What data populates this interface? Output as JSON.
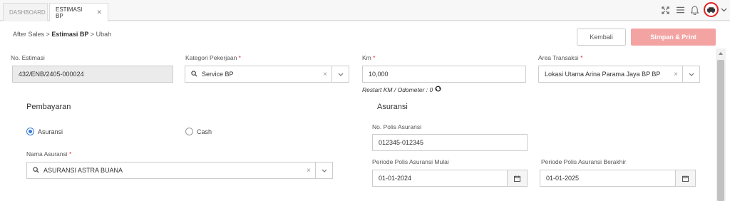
{
  "tabs": [
    {
      "label": "DASHBOARD"
    },
    {
      "label": "ESTIMASI BP"
    }
  ],
  "breadcrumb": {
    "root": "After Sales",
    "parent": "Estimasi BP",
    "current": "Ubah",
    "separator": ">"
  },
  "actions": {
    "back_label": "Kembali",
    "save_label": "Simpan & Print"
  },
  "form": {
    "no_estimasi": {
      "label": "No. Estimasi",
      "value": "432/ENB/2405-000024"
    },
    "kategori": {
      "label": "Kategori Pekerjaan",
      "required": "*",
      "value": "Service BP"
    },
    "km": {
      "label": "Km",
      "required": "*",
      "value": "10,000",
      "restart_text": "Restart KM / Odometer : 0"
    },
    "area": {
      "label": "Area Transaksi",
      "required": "*",
      "value": "Lokasi Utama Arina Parama Jaya BP BP"
    }
  },
  "pembayaran": {
    "title": "Pembayaran",
    "options": [
      {
        "label": "Asuransi",
        "checked": true
      },
      {
        "label": "Cash",
        "checked": false
      }
    ],
    "nama_asuransi": {
      "label": "Nama Asuransi",
      "required": "*",
      "value": "ASURANSI ASTRA BUANA"
    }
  },
  "asuransi": {
    "title": "Asuransi",
    "no_polis": {
      "label": "No. Polis Asuransi",
      "value": "012345-012345"
    },
    "periode_mulai": {
      "label": "Periode Polis Asuransi Mulai",
      "value": "01-01-2024"
    },
    "periode_berakhir": {
      "label": "Periode Polis Asuransi Berakhir",
      "value": "01-01-2025"
    }
  },
  "colors": {
    "accent": "#3a7bd5",
    "primary_button": "#f4a3a3",
    "avatar_border": "#e02020"
  },
  "icons": [
    "fullscreen-icon",
    "menu-icon",
    "bell-icon",
    "avatar-icon",
    "chevron-down-icon",
    "search-icon",
    "clear-icon",
    "refresh-icon",
    "calendar-icon"
  ]
}
